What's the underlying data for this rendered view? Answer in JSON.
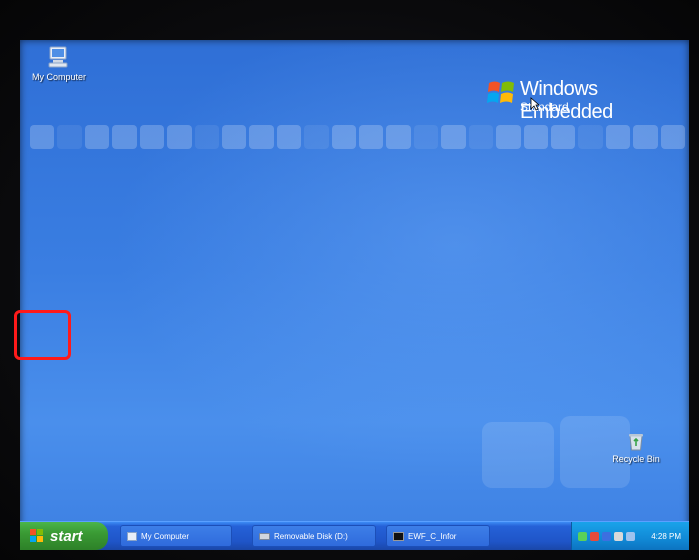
{
  "desktop": {
    "icons": {
      "my_computer": "My Computer",
      "recycle_bin": "Recycle Bin"
    },
    "brand": {
      "line1": "Windows Embedded",
      "line2": "Standard"
    }
  },
  "taskbar": {
    "start_label": "start",
    "tasks": [
      {
        "label": "My Computer",
        "icon": "computer-icon"
      },
      {
        "label": "Removable Disk (D:)",
        "icon": "drive-icon"
      },
      {
        "label": "EWF_C_Infor",
        "icon": "cmd-icon"
      }
    ],
    "clock": "4:28 PM"
  },
  "colors": {
    "desktop_blue": "#3a7ee2",
    "taskbar_blue": "#1f55c8",
    "start_green": "#3a9a34",
    "highlight_red": "#ff1a1a"
  }
}
